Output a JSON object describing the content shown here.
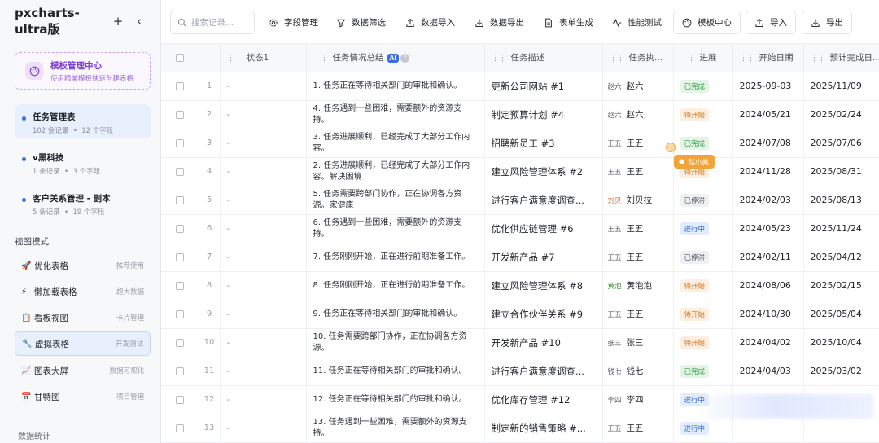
{
  "app": {
    "title": "pxcharts-ultra版",
    "add_label": "+",
    "collapse_label": "‹"
  },
  "template_card": {
    "title": "模板管理中心",
    "subtitle": "使用精美模板快速创建表格"
  },
  "tables": [
    {
      "name": "任务管理表",
      "records": "102 条记录",
      "fields": "12 个字段",
      "active": true
    },
    {
      "name": "v黑科技",
      "records": "1 条记录",
      "fields": "3 个字段",
      "active": false
    },
    {
      "name": "客户关系管理 - 副本",
      "records": "5 条记录",
      "fields": "19 个字段",
      "active": false
    }
  ],
  "meta_sep": "•",
  "view_section": "视图模式",
  "views": [
    {
      "icon": "🚀",
      "name": "优化表格",
      "tag": "推荐使用"
    },
    {
      "icon": "⚡",
      "name": "懒加载表格",
      "tag": "超大数据"
    },
    {
      "icon": "📋",
      "name": "看板视图",
      "tag": "卡片管理"
    },
    {
      "icon": "🔧",
      "name": "虚拟表格",
      "tag": "开发测试"
    },
    {
      "icon": "📈",
      "name": "图表大屏",
      "tag": "数据可视化"
    },
    {
      "icon": "📅",
      "name": "甘特图",
      "tag": "项目管理"
    }
  ],
  "data_section": "数据统计",
  "toolbar": {
    "search_placeholder": "搜索记录...",
    "field_mgmt": "字段管理",
    "filter": "数据筛选",
    "import_data": "数据导入",
    "export_data": "数据导出",
    "form": "表单生成",
    "perf": "性能测试",
    "template": "模板中心",
    "import": "导入",
    "export": "导出"
  },
  "columns": {
    "status": "状态1",
    "summary": "任务情况总结",
    "ai_tag": "AI",
    "help": "?",
    "desc": "任务描述",
    "owner": "任务执...",
    "progress": "进展",
    "start": "开始日期",
    "due": "预计完成日..."
  },
  "rows": [
    {
      "idx": "1",
      "status": "-",
      "summary": "1. 任务正在等待相关部门的审批和确认。",
      "desc": "更新公司网站 #1",
      "owner_short": "赵六",
      "owner": "赵六",
      "progress": "已完成",
      "start": "2025-09-03",
      "due": "2025/11/09"
    },
    {
      "idx": "2",
      "status": "-",
      "summary": "4. 任务遇到一些困难，需要额外的资源支持。",
      "desc": "制定预算计划 #4",
      "owner_short": "赵六",
      "owner": "赵六",
      "progress": "待开始",
      "start": "2024/05/21",
      "due": "2025/02/24"
    },
    {
      "idx": "3",
      "status": "-",
      "summary": "3. 任务进展顺利，已经完成了大部分工作内容。",
      "desc": "招聘新员工 #3",
      "owner_short": "王五",
      "owner": "王五",
      "progress": "已完成",
      "start": "2024/07/08",
      "due": "2025/07/06"
    },
    {
      "idx": "4",
      "status": "-",
      "summary": "2. 任务进展顺利，已经完成了大部分工作内容。解决困境",
      "desc": "建立风险管理体系 #2",
      "owner_short": "王五",
      "owner": "王五",
      "progress": "待开始",
      "start": "2024/11/28",
      "due": "2025/08/31"
    },
    {
      "idx": "5",
      "status": "-",
      "summary": "5. 任务需要跨部门协作，正在协调各方资源。家健康",
      "desc": "进行客户满意度调查...",
      "owner_short": "刘贝",
      "owner": "刘贝拉",
      "progress": "已停滞",
      "start": "2024/02/03",
      "due": "2025/08/13"
    },
    {
      "idx": "6",
      "status": "-",
      "summary": "6. 任务遇到一些困难，需要额外的资源支持。",
      "desc": "优化供应链管理 #6",
      "owner_short": "王五",
      "owner": "王五",
      "progress": "进行中",
      "start": "2024/05/23",
      "due": "2025/11/24"
    },
    {
      "idx": "7",
      "status": "-",
      "summary": "7. 任务刚刚开始，正在进行前期准备工作。",
      "desc": "开发新产品 #7",
      "owner_short": "王五",
      "owner": "王五",
      "progress": "已停滞",
      "start": "2024/02/11",
      "due": "2025/04/12"
    },
    {
      "idx": "8",
      "status": "-",
      "summary": "8. 任务刚刚开始，正在进行前期准备工作。",
      "desc": "建立风险管理体系 #8",
      "owner_short": "黄泡",
      "owner": "黄泡泡",
      "progress": "待开始",
      "start": "2024/08/06",
      "due": "2025/02/15"
    },
    {
      "idx": "9",
      "status": "-",
      "summary": "9. 任务正在等待相关部门的审批和确认。",
      "desc": "建立合作伙伴关系 #9",
      "owner_short": "王五",
      "owner": "王五",
      "progress": "待开始",
      "start": "2024/10/30",
      "due": "2025/05/04"
    },
    {
      "idx": "10",
      "status": "-",
      "summary": "10. 任务需要跨部门协作，正在协调各方资源。",
      "desc": "开发新产品 #10",
      "owner_short": "张三",
      "owner": "张三",
      "progress": "待开始",
      "start": "2024/04/02",
      "due": "2025/10/04"
    },
    {
      "idx": "11",
      "status": "-",
      "summary": "11. 任务正在等待相关部门的审批和确认。",
      "desc": "进行客户满意度调查...",
      "owner_short": "钱七",
      "owner": "钱七",
      "progress": "已完成",
      "start": "2024/04/03",
      "due": "2025/03/02"
    },
    {
      "idx": "12",
      "status": "-",
      "summary": "12. 任务正在等待相关部门的审批和确认。",
      "desc": "优化库存管理 #12",
      "owner_short": "李四",
      "owner": "李四",
      "progress": "进行中",
      "start": "",
      "due": ""
    },
    {
      "idx": "13",
      "status": "-",
      "summary": "13. 任务遇到一些困难，需要额外的资源支持。",
      "desc": "制定新的销售策略 #...",
      "owner_short": "王五",
      "owner": "王五",
      "progress": "进行中",
      "start": "",
      "due": ""
    }
  ],
  "cursor_user": "赵小美",
  "colors": {
    "accent": "#3b6fe0",
    "template_purple": "#7b3fd6",
    "cursor_orange": "#f2a33a"
  }
}
